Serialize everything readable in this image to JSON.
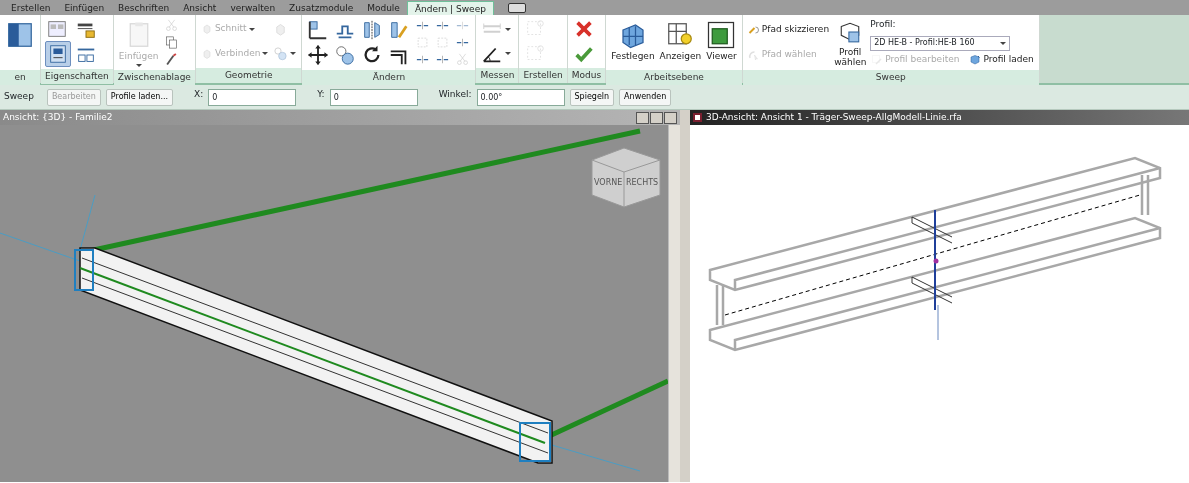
{
  "tabs": [
    {
      "label": "Erstellen",
      "selected": false
    },
    {
      "label": "Einfügen",
      "selected": false
    },
    {
      "label": "Beschriften",
      "selected": false
    },
    {
      "label": "Ansicht",
      "selected": false
    },
    {
      "label": "verwalten",
      "selected": false
    },
    {
      "label": "Zusatzmodule",
      "selected": false
    },
    {
      "label": "Module",
      "selected": false
    },
    {
      "label": "Ändern | Sweep",
      "selected": true
    }
  ],
  "ribbon": {
    "groups": [
      {
        "label": "en",
        "columns": [
          [
            {
              "kind": "large",
              "disabled": false
            }
          ]
        ]
      },
      {
        "label": "Eigenschaften",
        "columns": [
          [
            {
              "kind": "icon",
              "disabled": false,
              "on": false
            },
            {
              "kind": "icon",
              "disabled": false,
              "on": true
            }
          ],
          [
            {
              "kind": "icon",
              "disabled": false,
              "on": false
            },
            {
              "kind": "icon",
              "disabled": false,
              "on": false
            }
          ]
        ]
      },
      {
        "label": "Zwischenablage",
        "columns": [
          [
            {
              "kind": "large",
              "label": "Einfügen",
              "disabled": true,
              "dropdown": true
            }
          ],
          [
            {
              "kind": "tiny",
              "disabled": true
            },
            {
              "kind": "tiny",
              "disabled": false
            },
            {
              "kind": "tiny",
              "disabled": false
            }
          ]
        ]
      },
      {
        "label": "Geometrie",
        "columns": [
          [
            {
              "kind": "small",
              "label": "Schnitt",
              "disabled": true,
              "dropdown": true
            },
            {
              "kind": "small",
              "label": "Verbinden",
              "disabled": true,
              "dropdown": true
            }
          ],
          [
            {
              "kind": "tiny",
              "disabled": true
            },
            {
              "kind": "tiny",
              "disabled": true,
              "dropdown": true
            }
          ]
        ]
      },
      {
        "label": "Ändern",
        "columns": [
          [
            {
              "kind": "icon",
              "disabled": false
            },
            {
              "kind": "icon",
              "disabled": false
            }
          ],
          [
            {
              "kind": "icon",
              "disabled": false
            },
            {
              "kind": "icon",
              "disabled": false
            }
          ],
          [
            {
              "kind": "icon",
              "disabled": false
            },
            {
              "kind": "icon",
              "disabled": false
            }
          ],
          [
            {
              "kind": "icon",
              "disabled": false
            },
            {
              "kind": "icon",
              "disabled": false
            }
          ],
          [
            {
              "kind": "tiny",
              "disabled": false
            },
            {
              "kind": "tiny",
              "disabled": true
            },
            {
              "kind": "tiny",
              "disabled": false
            }
          ],
          [
            {
              "kind": "tiny",
              "disabled": false
            },
            {
              "kind": "tiny",
              "disabled": true
            },
            {
              "kind": "tiny",
              "disabled": false
            }
          ],
          [
            {
              "kind": "tiny",
              "disabled": true
            },
            {
              "kind": "tiny",
              "disabled": false
            },
            {
              "kind": "tiny",
              "disabled": true
            }
          ]
        ]
      },
      {
        "label": "Messen",
        "columns": [
          [
            {
              "kind": "icon",
              "disabled": true,
              "dropdown": true
            },
            {
              "kind": "icon",
              "disabled": false,
              "dropdown": true
            }
          ]
        ]
      },
      {
        "label": "Erstellen",
        "columns": [
          [
            {
              "kind": "icon",
              "disabled": true
            },
            {
              "kind": "icon",
              "disabled": true
            }
          ]
        ]
      },
      {
        "label": "Modus",
        "columns": [
          [
            {
              "kind": "icon",
              "disabled": false
            },
            {
              "kind": "icon",
              "disabled": false
            }
          ]
        ]
      },
      {
        "label": "Arbeitsebene",
        "columns": [
          [
            {
              "kind": "large",
              "label": "Festlegen",
              "disabled": false
            }
          ],
          [
            {
              "kind": "large",
              "label": "Anzeigen",
              "disabled": false
            }
          ],
          [
            {
              "kind": "large",
              "label": "Viewer",
              "disabled": false
            }
          ]
        ]
      },
      {
        "label": "Sweep",
        "columns": [
          [
            {
              "kind": "small",
              "label": "Pfad skizzieren",
              "disabled": false
            },
            {
              "kind": "small",
              "label": "Pfad wählen",
              "disabled": true
            }
          ],
          [
            {
              "kind": "large",
              "label": "Profil wählen",
              "disabled": false
            }
          ],
          [
            {
              "kind": "combo",
              "label": "Profil:",
              "value": "2D HE-B - Profil:HE-B 160"
            },
            {
              "kind": "row",
              "items": [
                {
                  "kind": "small",
                  "label": "Profil bearbeiten",
                  "disabled": true
                },
                {
                  "kind": "small",
                  "label": "Profil laden",
                  "disabled": false
                }
              ]
            }
          ]
        ]
      }
    ]
  },
  "options_bar": {
    "title": "Sweep",
    "controls": [
      {
        "kind": "button",
        "label": "Bearbeiten",
        "disabled": true
      },
      {
        "kind": "button",
        "label": "Profile laden...",
        "disabled": false
      },
      {
        "kind": "field",
        "label": "X:",
        "value": "0"
      },
      {
        "kind": "field",
        "label": "Y:",
        "value": "0"
      },
      {
        "kind": "field",
        "label": "Winkel:",
        "value": "0.00°"
      },
      {
        "kind": "button",
        "label": "Spiegeln",
        "disabled": false
      },
      {
        "kind": "button",
        "label": "Anwenden",
        "disabled": false
      }
    ]
  },
  "views": [
    {
      "title": "Ansicht: {3D} - Familie2",
      "active": false,
      "viewcube": [
        "VORNE",
        "RECHTS"
      ]
    },
    {
      "title": "3D-Ansicht: Ansicht 1 - Träger-Sweep-AllgModell-Linie.rfa",
      "active": true
    }
  ]
}
